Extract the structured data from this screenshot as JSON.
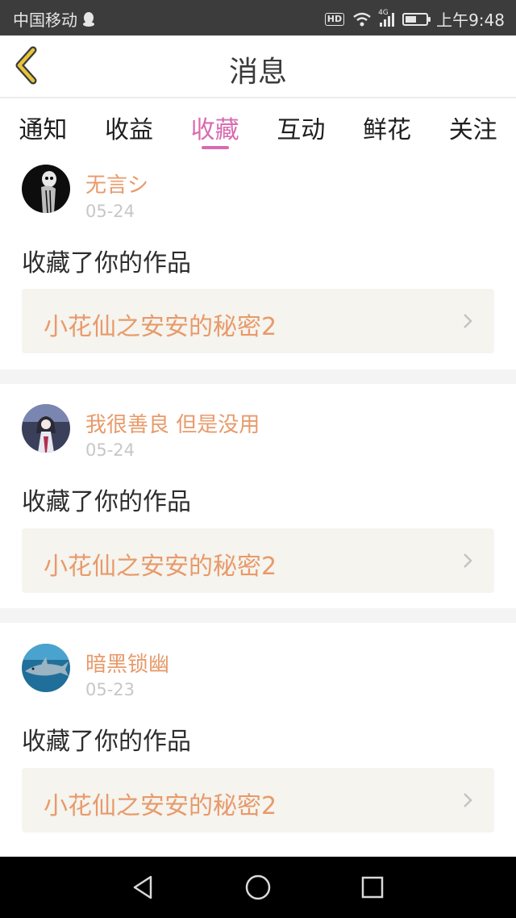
{
  "status_bar": {
    "carrier": "中国移动",
    "hd": "HD",
    "network": "4G",
    "time": "上午9:48",
    "battery_level": 0.55,
    "colors": {
      "background": "#3c3c3c",
      "foreground": "#e6e6e6"
    },
    "icons": [
      "qq-icon",
      "wifi-icon",
      "signal-icon",
      "battery-icon"
    ]
  },
  "header": {
    "title": "消息",
    "back_icon": "chevron-left-icon",
    "accent": "#e8c43a"
  },
  "tabs": {
    "items": [
      {
        "label": "通知"
      },
      {
        "label": "收益"
      },
      {
        "label": "收藏",
        "active": true
      },
      {
        "label": "互动"
      },
      {
        "label": "鲜花"
      },
      {
        "label": "关注"
      }
    ],
    "active_color": "#d86bb1"
  },
  "messages": [
    {
      "user": "无言シ",
      "date": "05-24",
      "action": "收藏了你的作品",
      "work_title": "小花仙之安安的秘密2",
      "avatar": "skeleton-avatar"
    },
    {
      "user": "我很善良 但是没用",
      "date": "05-24",
      "action": "收藏了你的作品",
      "work_title": "小花仙之安安的秘密2",
      "avatar": "anime-girl-avatar"
    },
    {
      "user": "暗黑锁幽",
      "date": "05-23",
      "action": "收藏了你的作品",
      "work_title": "小花仙之安安的秘密2",
      "avatar": "shark-avatar"
    }
  ],
  "colors": {
    "username": "#e89a6a",
    "date": "#c7c7c7",
    "work_bg": "#f5f4ef"
  },
  "nav_bar": {
    "icons": [
      "back-triangle-icon",
      "home-circle-icon",
      "recents-square-icon"
    ]
  }
}
